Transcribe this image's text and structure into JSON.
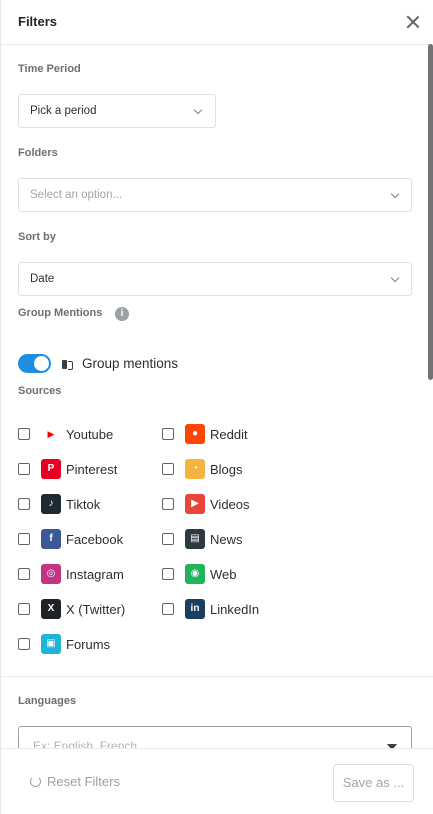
{
  "header": {
    "title": "Filters"
  },
  "time_period": {
    "label": "Time Period",
    "value": "Pick a period"
  },
  "folders": {
    "label": "Folders",
    "placeholder": "Select an option..."
  },
  "sort_by": {
    "label": "Sort by",
    "value": "Date"
  },
  "group_mentions": {
    "label": "Group Mentions",
    "info": "i",
    "toggle_on": true,
    "toggle_label": "Group mentions"
  },
  "sources": {
    "label": "Sources",
    "items": [
      {
        "label": "Youtube",
        "icon": "youtube-icon",
        "glyph": "▶",
        "color": "#ff0000",
        "checked": false
      },
      {
        "label": "Reddit",
        "icon": "reddit-icon",
        "glyph": "●",
        "color": "#ff4500",
        "checked": false
      },
      {
        "label": "Pinterest",
        "icon": "pinterest-icon",
        "glyph": "P",
        "color": "#e60023",
        "checked": false
      },
      {
        "label": "Blogs",
        "icon": "rss-icon",
        "glyph": "◔",
        "color": "#f5b340",
        "checked": false
      },
      {
        "label": "Tiktok",
        "icon": "tiktok-icon",
        "glyph": "♪",
        "color": "#1e2a33",
        "checked": false
      },
      {
        "label": "Videos",
        "icon": "video-icon",
        "glyph": "▶",
        "color": "#e8453c",
        "checked": false
      },
      {
        "label": "Facebook",
        "icon": "facebook-icon",
        "glyph": "f",
        "color": "#3b5998",
        "checked": false
      },
      {
        "label": "News",
        "icon": "news-icon",
        "glyph": "▤",
        "color": "#2c3a44",
        "checked": false
      },
      {
        "label": "Instagram",
        "icon": "instagram-icon",
        "glyph": "◎",
        "color": "#c13584",
        "checked": false
      },
      {
        "label": "Web",
        "icon": "web-icon",
        "glyph": "◉",
        "color": "#22b35c",
        "checked": false
      },
      {
        "label": "X (Twitter)",
        "icon": "x-icon",
        "glyph": "X",
        "color": "#1f2327",
        "checked": false
      },
      {
        "label": "LinkedIn",
        "icon": "linkedin-icon",
        "glyph": "in",
        "color": "#1d3f5e",
        "checked": false
      },
      {
        "label": "Forums",
        "icon": "forums-icon",
        "glyph": "▣",
        "color": "#1fb5d8",
        "checked": false
      }
    ]
  },
  "languages": {
    "label": "Languages",
    "placeholder": "Ex: English, French"
  },
  "footer": {
    "reset_label": "Reset Filters",
    "save_label": "Save as ..."
  }
}
